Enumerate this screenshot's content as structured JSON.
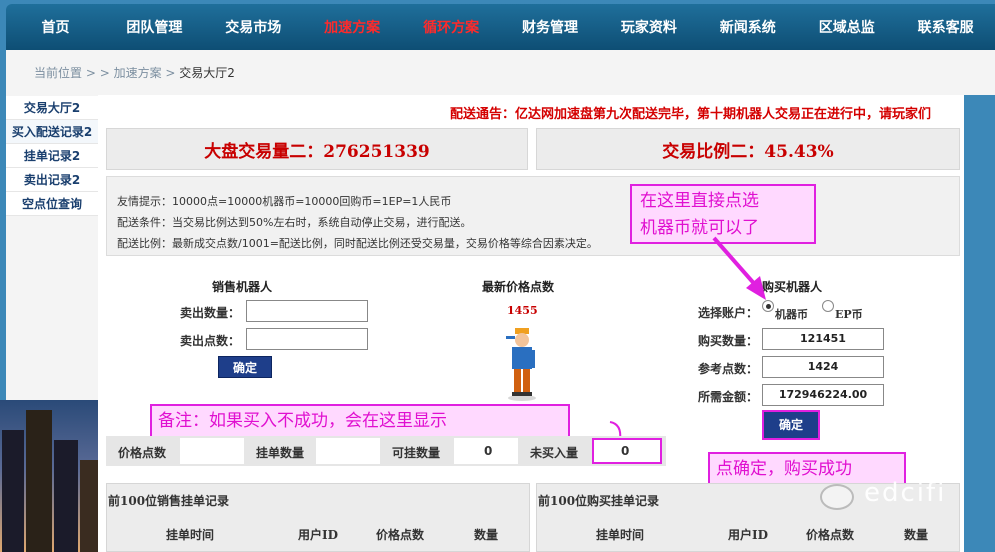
{
  "nav": {
    "items": [
      {
        "label": "首页"
      },
      {
        "label": "团队管理"
      },
      {
        "label": "交易市场"
      },
      {
        "label": "加速方案"
      },
      {
        "label": "循环方案"
      },
      {
        "label": "财务管理"
      },
      {
        "label": "玩家资料"
      },
      {
        "label": "新闻系统"
      },
      {
        "label": "区域总监"
      },
      {
        "label": "联系客服"
      }
    ],
    "highlight_color": "#ff2a2a"
  },
  "breadcrumb": {
    "root": "当前位置",
    "sep1": " > > ",
    "mid": "加速方案",
    "sep2": " > ",
    "current": "交易大厅2"
  },
  "sidebar": {
    "items": [
      {
        "label": "交易大厅2"
      },
      {
        "label": "买入配送记录2"
      },
      {
        "label": "挂单记录2"
      },
      {
        "label": "卖出记录2"
      },
      {
        "label": "空点位查询"
      }
    ]
  },
  "notice": "配送通告：亿达网加速盘第九次配送完毕，第十期机器人交易正在进行中，请玩家们",
  "stats": {
    "volume": "大盘交易量二：276251339",
    "ratio": "交易比例二：45.43%"
  },
  "info": {
    "line1": "友情提示：10000点=10000机器币=10000回购币=1EP=1人民币",
    "line2": "配送条件：当交易比例达到50%左右时，系统自动停止交易，进行配送。",
    "line3": "配送比例：最新成交点数/1001=配送比例，同时配送比例还受交易量，交易价格等综合因素决定。"
  },
  "sell": {
    "title": "销售机器人",
    "qty_label": "卖出数量：",
    "points_label": "卖出点数：",
    "confirm": "确定"
  },
  "latest": {
    "title": "最新价格点数",
    "value": "1455"
  },
  "buy": {
    "title": "购买机器人",
    "account_label": "选择账户：",
    "opt1": "机器币",
    "opt2": "EP币",
    "qty_label": "购买数量：",
    "qty_value": "121451",
    "ref_label": "参考点数：",
    "ref_value": "1424",
    "amount_label": "所需金额：",
    "amount_value": "172946224.00",
    "confirm": "确定"
  },
  "callouts": {
    "top": "在这里直接点选机器币就可以了",
    "top_line1": "在这里直接点选",
    "top_line2": "机器币就可以了",
    "note": "备注：如果买入不成功，会在这里显示",
    "success": "点确定，购买成功"
  },
  "summary": {
    "price_label": "价格点数",
    "pending_label": "挂单数量",
    "available_label": "可挂数量",
    "available_value": "0",
    "unbought_label": "未买入量",
    "unbought_value": "0"
  },
  "sell_table": {
    "title": "前100位销售挂单记录",
    "headers": [
      "挂单时间",
      "用户ID",
      "价格点数",
      "数量"
    ]
  },
  "buy_table": {
    "title": "前100位购买挂单记录",
    "headers": [
      "挂单时间",
      "用户ID",
      "价格点数",
      "数量"
    ]
  },
  "watermark": "edcifi",
  "colors": {
    "callout_border": "#e020e0",
    "callout_fill": "#ffd9ff",
    "button": "#1e3e8a",
    "stat_red": "#c80000"
  }
}
